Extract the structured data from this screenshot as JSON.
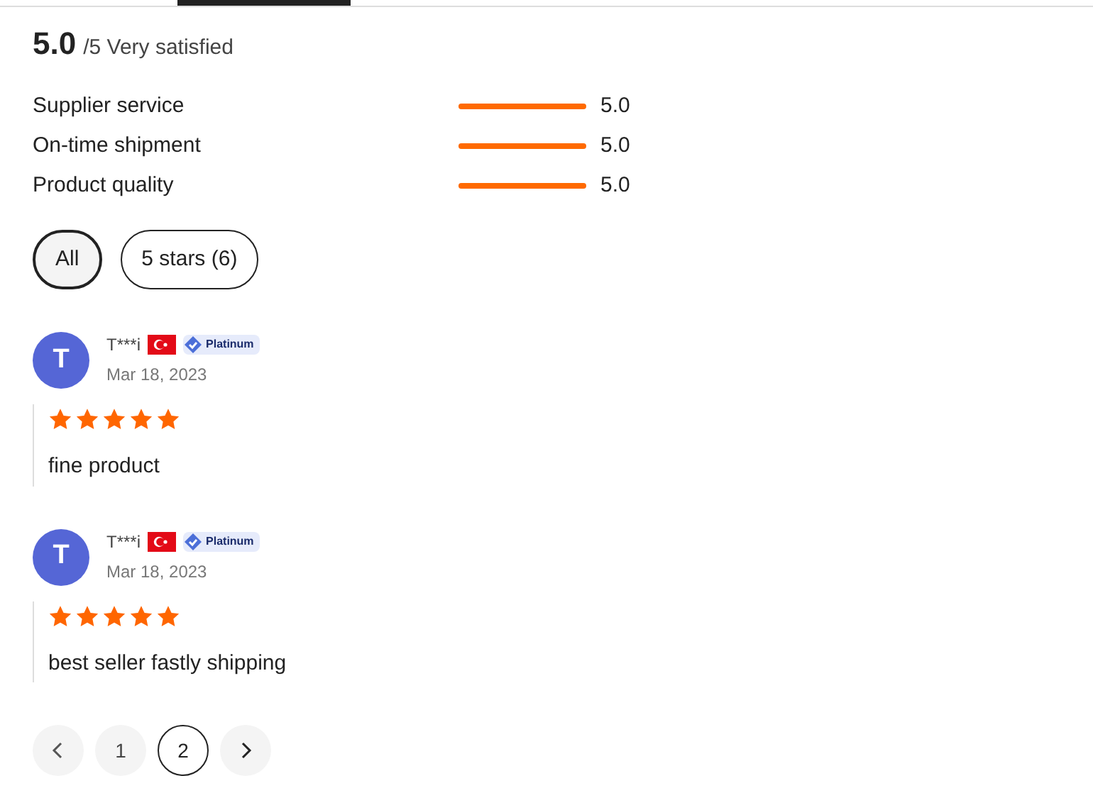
{
  "summary": {
    "score": "5.0",
    "suffix": "/5 Very satisfied"
  },
  "ratings": [
    {
      "label": "Supplier service",
      "level": 1,
      "value": "5.0"
    },
    {
      "label": "On-time shipment",
      "level": 1,
      "value": "5.0"
    },
    {
      "label": "Product quality",
      "level": 1,
      "value": "5.0"
    }
  ],
  "filters": [
    {
      "label": "All",
      "selected": true
    },
    {
      "label": "5 stars (6)",
      "selected": false
    }
  ],
  "reviews": [
    {
      "avatar": "T",
      "name": "T***i",
      "badge": "Platinum",
      "date": "Mar 18, 2023",
      "stars": 5,
      "text": "fine product"
    },
    {
      "avatar": "T",
      "name": "T***i",
      "badge": "Platinum",
      "date": "Mar 18, 2023",
      "stars": 5,
      "text": "best seller fastly shipping"
    }
  ],
  "pagination": {
    "pages": [
      {
        "label": "1",
        "selected": false
      },
      {
        "label": "2",
        "selected": true
      }
    ]
  }
}
